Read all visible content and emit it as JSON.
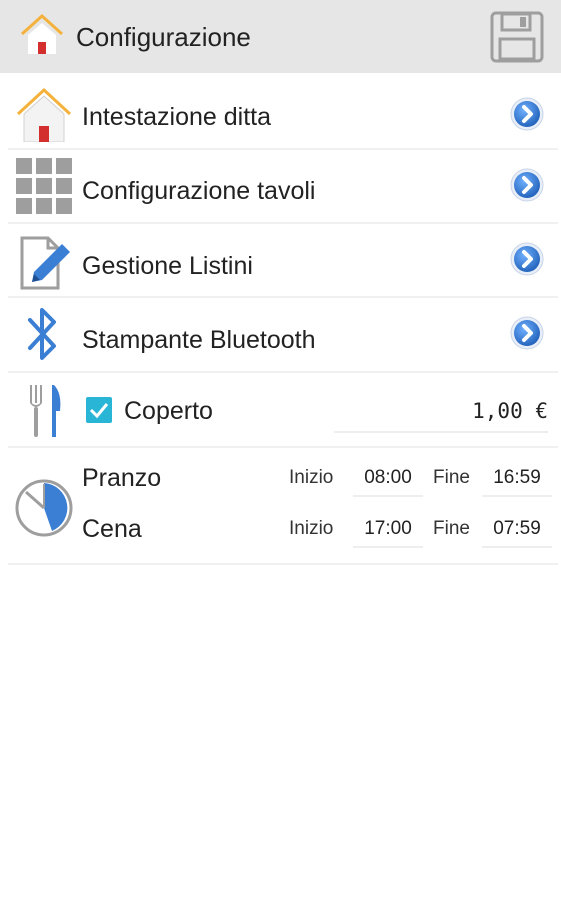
{
  "appbar": {
    "title": "Configurazione",
    "home_icon": "home-icon",
    "save_icon": "floppy-disk-icon"
  },
  "menu": [
    {
      "label": "Intestazione ditta",
      "icon": "home-icon"
    },
    {
      "label": "Configurazione tavoli",
      "icon": "grid-icon"
    },
    {
      "label": "Gestione Listini",
      "icon": "edit-document-icon"
    },
    {
      "label": "Stampante Bluetooth",
      "icon": "bluetooth-icon"
    }
  ],
  "coperto": {
    "label": "Coperto",
    "checked": true,
    "value": "1,00 €"
  },
  "orari": {
    "pranzo": {
      "label": "Pranzo",
      "start_label": "Inizio",
      "start": "08:00",
      "end_label": "Fine",
      "end": "16:59"
    },
    "cena": {
      "label": "Cena",
      "start_label": "Inizio",
      "start": "17:00",
      "end_label": "Fine",
      "end": "07:59"
    }
  },
  "colors": {
    "appbar_bg": "#e6e6e6",
    "accent_blue": "#2f7fd8",
    "checkbox": "#29b6d6",
    "icon_gray": "#9e9e9e",
    "roof_orange": "#f4b23d",
    "door_red": "#d32f2f"
  }
}
